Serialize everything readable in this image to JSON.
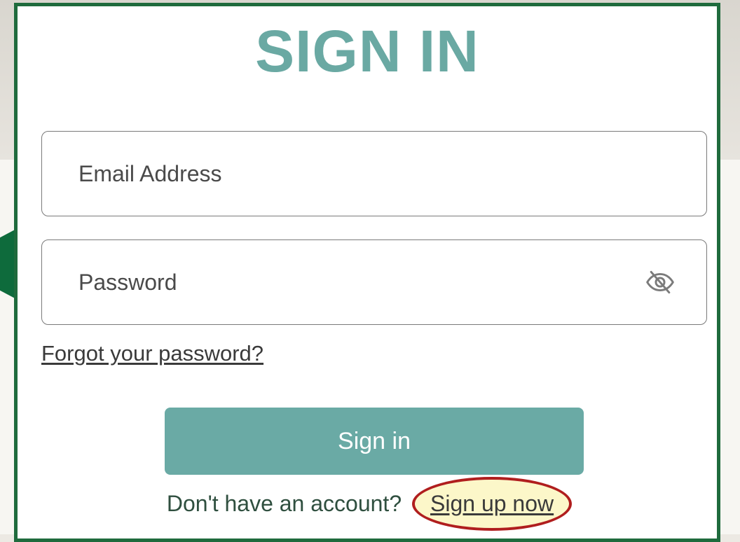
{
  "modal": {
    "title": "SIGN IN",
    "border_color": "#1f6b3d",
    "accent_color": "#6aa9a3"
  },
  "email": {
    "placeholder": "Email Address"
  },
  "password": {
    "placeholder": "Password",
    "toggle_icon": "eye-off-icon"
  },
  "forgot_link": "Forgot your password?",
  "signin_button": "Sign in",
  "signup": {
    "prompt": "Don't have an account?",
    "link": "Sign up now",
    "annotation_color": "#b01e1e"
  }
}
